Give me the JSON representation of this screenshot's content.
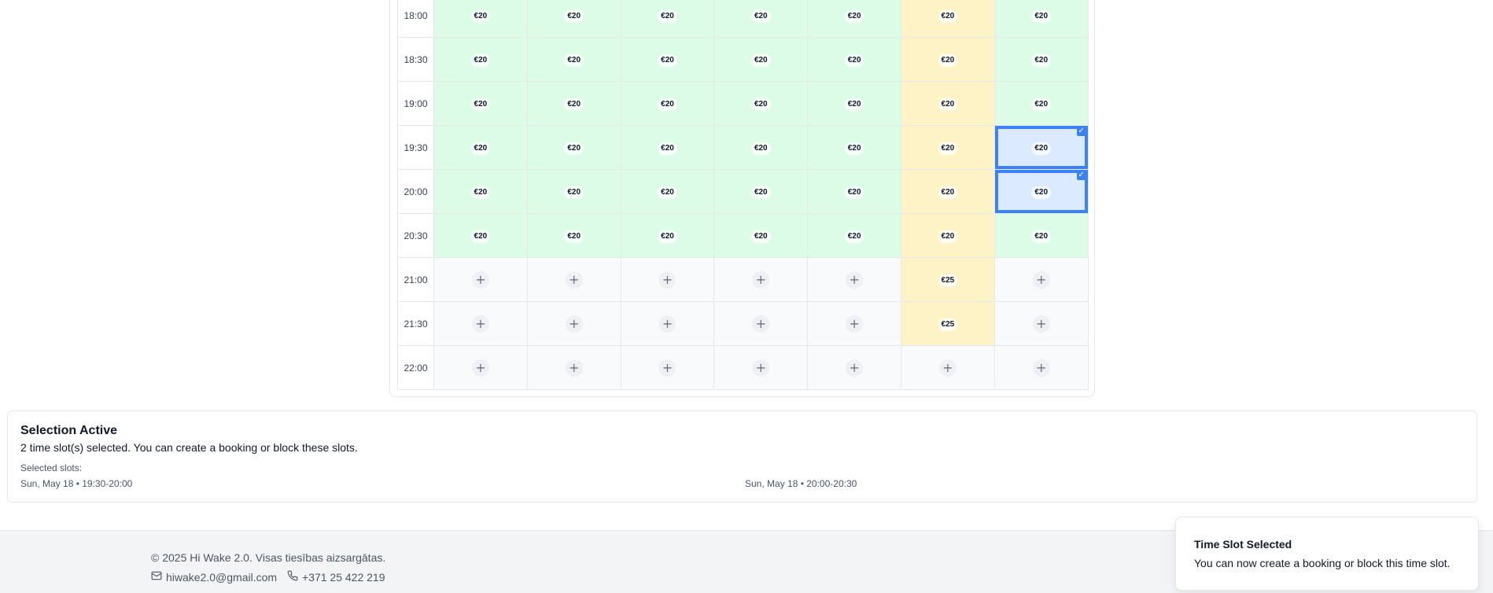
{
  "schedule": {
    "rows": [
      {
        "time": "18:00",
        "cells": [
          {
            "state": "avail",
            "price": "€20"
          },
          {
            "state": "avail",
            "price": "€20"
          },
          {
            "state": "avail",
            "price": "€20"
          },
          {
            "state": "avail",
            "price": "€20"
          },
          {
            "state": "avail",
            "price": "€20"
          },
          {
            "state": "weekend",
            "price": "€20"
          },
          {
            "state": "avail",
            "price": "€20"
          }
        ]
      },
      {
        "time": "18:30",
        "cells": [
          {
            "state": "avail",
            "price": "€20"
          },
          {
            "state": "avail",
            "price": "€20"
          },
          {
            "state": "avail",
            "price": "€20"
          },
          {
            "state": "avail",
            "price": "€20"
          },
          {
            "state": "avail",
            "price": "€20"
          },
          {
            "state": "weekend",
            "price": "€20"
          },
          {
            "state": "avail",
            "price": "€20"
          }
        ]
      },
      {
        "time": "19:00",
        "cells": [
          {
            "state": "avail",
            "price": "€20"
          },
          {
            "state": "avail",
            "price": "€20"
          },
          {
            "state": "avail",
            "price": "€20"
          },
          {
            "state": "avail",
            "price": "€20"
          },
          {
            "state": "avail",
            "price": "€20"
          },
          {
            "state": "weekend",
            "price": "€20"
          },
          {
            "state": "avail",
            "price": "€20"
          }
        ]
      },
      {
        "time": "19:30",
        "cells": [
          {
            "state": "avail",
            "price": "€20"
          },
          {
            "state": "avail",
            "price": "€20"
          },
          {
            "state": "avail",
            "price": "€20"
          },
          {
            "state": "avail",
            "price": "€20"
          },
          {
            "state": "avail",
            "price": "€20"
          },
          {
            "state": "weekend",
            "price": "€20"
          },
          {
            "state": "selected",
            "price": "€20"
          }
        ]
      },
      {
        "time": "20:00",
        "cells": [
          {
            "state": "avail",
            "price": "€20"
          },
          {
            "state": "avail",
            "price": "€20"
          },
          {
            "state": "avail",
            "price": "€20"
          },
          {
            "state": "avail",
            "price": "€20"
          },
          {
            "state": "avail",
            "price": "€20"
          },
          {
            "state": "weekend",
            "price": "€20"
          },
          {
            "state": "selected",
            "price": "€20"
          }
        ]
      },
      {
        "time": "20:30",
        "cells": [
          {
            "state": "avail",
            "price": "€20"
          },
          {
            "state": "avail",
            "price": "€20"
          },
          {
            "state": "avail",
            "price": "€20"
          },
          {
            "state": "avail",
            "price": "€20"
          },
          {
            "state": "avail",
            "price": "€20"
          },
          {
            "state": "weekend",
            "price": "€20"
          },
          {
            "state": "avail",
            "price": "€20"
          }
        ]
      },
      {
        "time": "21:00",
        "cells": [
          {
            "state": "empty"
          },
          {
            "state": "empty"
          },
          {
            "state": "empty"
          },
          {
            "state": "empty"
          },
          {
            "state": "empty"
          },
          {
            "state": "weekend",
            "price": "€25"
          },
          {
            "state": "empty"
          }
        ]
      },
      {
        "time": "21:30",
        "cells": [
          {
            "state": "empty"
          },
          {
            "state": "empty"
          },
          {
            "state": "empty"
          },
          {
            "state": "empty"
          },
          {
            "state": "empty"
          },
          {
            "state": "weekend",
            "price": "€25"
          },
          {
            "state": "empty"
          }
        ]
      },
      {
        "time": "22:00",
        "cells": [
          {
            "state": "empty"
          },
          {
            "state": "empty"
          },
          {
            "state": "empty"
          },
          {
            "state": "empty"
          },
          {
            "state": "empty"
          },
          {
            "state": "empty"
          },
          {
            "state": "empty"
          }
        ]
      }
    ],
    "plus_glyph": "+",
    "check_glyph": "✓"
  },
  "selection": {
    "title": "Selection Active",
    "description": "2 time slot(s) selected. You can create a booking or block these slots.",
    "selected_label": "Selected slots:",
    "slots": [
      "Sun, May 18 • 19:30-20:00",
      "Sun, May 18 • 20:00-20:30"
    ]
  },
  "footer": {
    "copyright": "© 2025 Hi Wake 2.0. Visas tiesības aizsargātas.",
    "email": "hiwake2.0@gmail.com",
    "phone": "+371 25 422 219"
  },
  "toast": {
    "title": "Time Slot Selected",
    "description": "You can now create a booking or block this time slot."
  },
  "colors": {
    "available": "#dcfce7",
    "weekend": "#fef3c7",
    "empty": "#f9fafb",
    "selected_fill": "#dbeafe",
    "selected_border": "#3b82f6"
  }
}
